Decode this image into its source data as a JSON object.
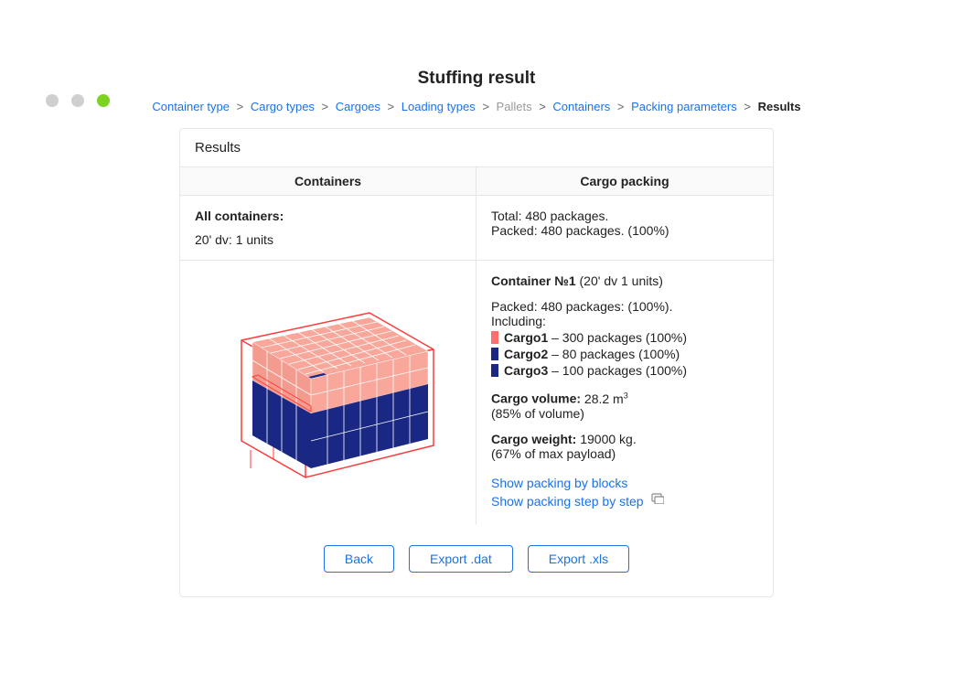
{
  "page_title": "Stuffing result",
  "breadcrumb": {
    "items": [
      {
        "label": "Container type",
        "muted": false
      },
      {
        "label": "Cargo types",
        "muted": false
      },
      {
        "label": "Cargoes",
        "muted": false
      },
      {
        "label": "Loading types",
        "muted": false
      },
      {
        "label": "Pallets",
        "muted": true
      },
      {
        "label": "Containers",
        "muted": false
      },
      {
        "label": "Packing parameters",
        "muted": false
      }
    ],
    "current": "Results"
  },
  "panel": {
    "header": "Results",
    "cols": {
      "containers": "Containers",
      "cargo_packing": "Cargo packing"
    }
  },
  "summary": {
    "all_label": "All containers:",
    "container_line": "20' dv: 1 units",
    "total_line": "Total: 480 packages.",
    "packed_line": "Packed: 480 packages. (100%)"
  },
  "detail": {
    "title_prefix": "Container №1",
    "title_suffix": "(20' dv 1 units)",
    "packed_line": "Packed: 480 packages: (100%).",
    "including_label": "Including:",
    "cargoes": [
      {
        "name": "Cargo1",
        "rest": " – 300 packages (100%)",
        "color": "#ff6d6d"
      },
      {
        "name": "Cargo2",
        "rest": " – 80 packages (100%)",
        "color": "#1a2884"
      },
      {
        "name": "Cargo3",
        "rest": " – 100 packages (100%)",
        "color": "#1a2884"
      }
    ],
    "volume_label": "Cargo volume:",
    "volume_value": "28.2 m",
    "volume_unit_sup": "3",
    "volume_pct": "(85% of volume)",
    "weight_label": "Cargo weight:",
    "weight_value": "19000 kg.",
    "weight_pct": "(67% of max payload)",
    "link_blocks": "Show packing by blocks",
    "link_steps": "Show packing step by step"
  },
  "buttons": {
    "back": "Back",
    "export_dat": "Export .dat",
    "export_xls": "Export .xls"
  }
}
